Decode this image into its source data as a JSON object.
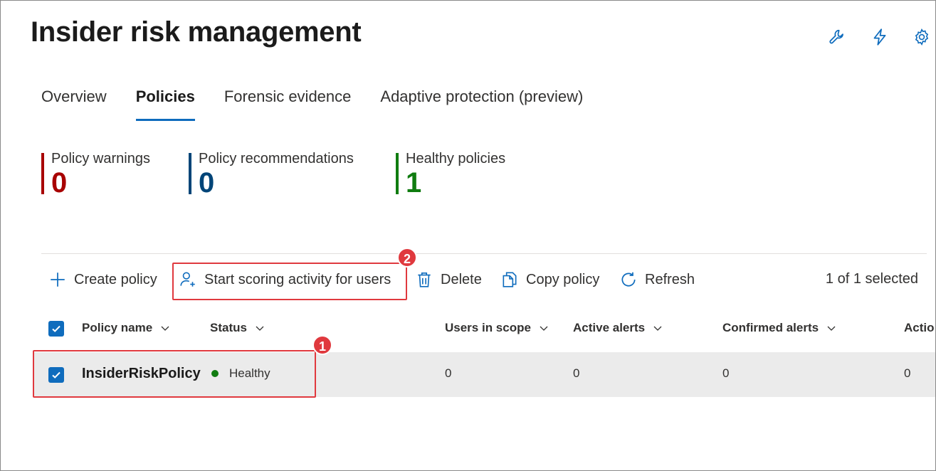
{
  "page": {
    "title": "Insider risk management"
  },
  "top_icons": [
    "wrench-icon",
    "lightning-icon",
    "gear-icon"
  ],
  "tabs": [
    {
      "label": "Overview",
      "active": false
    },
    {
      "label": "Policies",
      "active": true
    },
    {
      "label": "Forensic evidence",
      "active": false
    },
    {
      "label": "Adaptive protection (preview)",
      "active": false
    }
  ],
  "kpis": [
    {
      "label": "Policy warnings",
      "value": "0",
      "color": "#a80000"
    },
    {
      "label": "Policy recommendations",
      "value": "0",
      "color": "#004578"
    },
    {
      "label": "Healthy policies",
      "value": "1",
      "color": "#107c10"
    }
  ],
  "toolbar": {
    "create_policy": "Create policy",
    "start_scoring": "Start scoring activity for users",
    "delete": "Delete",
    "copy_policy": "Copy policy",
    "refresh": "Refresh",
    "selected_count": "1 of 1 selected"
  },
  "table": {
    "columns": [
      "Policy name",
      "Status",
      "Users in scope",
      "Active alerts",
      "Confirmed alerts",
      "Actio"
    ],
    "rows": [
      {
        "policy_name": "InsiderRiskPolicy",
        "status": "Healthy",
        "users_in_scope": "0",
        "active_alerts": "0",
        "confirmed_alerts": "0",
        "actions": "0",
        "selected": true
      }
    ]
  },
  "callouts": {
    "row_badge": "1",
    "button_badge": "2"
  },
  "colors": {
    "accent": "#0f6cbd",
    "callout": "#e0393e",
    "healthy": "#107c10"
  }
}
